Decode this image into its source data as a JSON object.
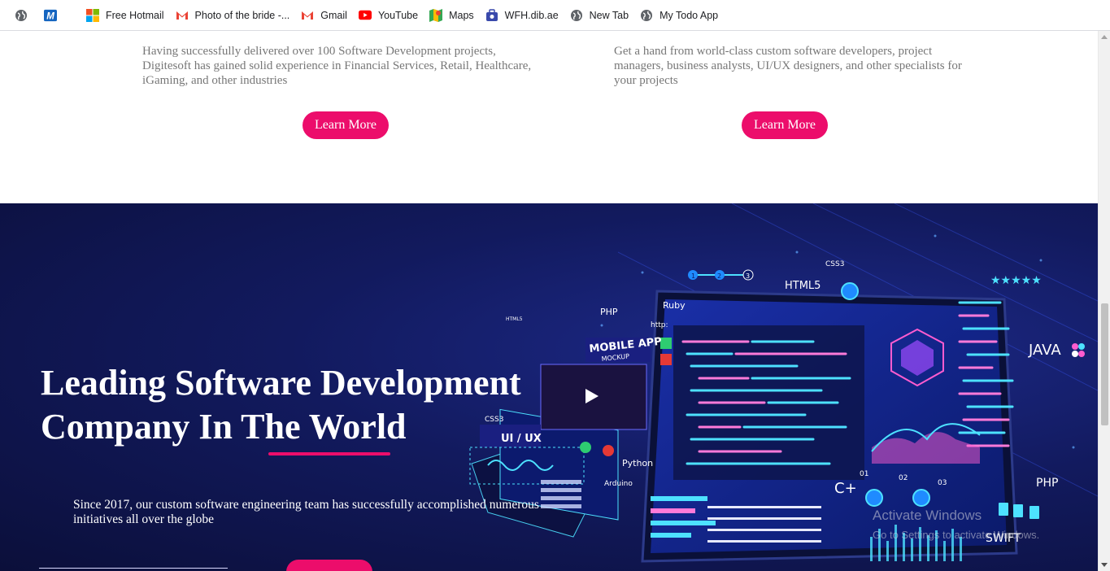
{
  "bookmarks": [
    {
      "label": "",
      "icon": "globe-icon"
    },
    {
      "label": "",
      "icon": "outlook-m-icon"
    },
    {
      "label": "Free Hotmail",
      "icon": "microsoft-icon"
    },
    {
      "label": "Photo of the bride -...",
      "icon": "gmail-icon"
    },
    {
      "label": "Gmail",
      "icon": "gmail-icon"
    },
    {
      "label": "YouTube",
      "icon": "youtube-icon"
    },
    {
      "label": "Maps",
      "icon": "maps-icon"
    },
    {
      "label": "WFH.dib.ae",
      "icon": "wfh-icon"
    },
    {
      "label": "New Tab",
      "icon": "globe-icon"
    },
    {
      "label": "My Todo App",
      "icon": "globe-icon"
    }
  ],
  "features": [
    {
      "text": "Having successfully delivered over 100 Software Development projects, Digitesoft has gained solid experience in Financial Services, Retail, Healthcare, iGaming, and other industries",
      "button": "Learn More"
    },
    {
      "text": "Get a hand from world-class custom software developers, project managers, business analysts, UI/UX designers, and other specialists for your projects",
      "button": "Learn More"
    }
  ],
  "hero": {
    "title_line1": "Leading Software Development",
    "title_line2": "Company In The World",
    "subtitle_line1": "Since 2017, our custom software engineering team has successfully accomplished numerous",
    "subtitle_line2": "initiatives all over the globe",
    "illustration_labels": {
      "php_top": "PHP",
      "ruby": "Ruby",
      "http": "http:",
      "html5": "HTML5",
      "css3_top": "CSS3",
      "mobile_app": "MOBILE APP",
      "mockup": "MOCKUP",
      "ui_ux": "UI / UX",
      "css3_left": "CSS3",
      "python": "Python",
      "arduino": "Arduino",
      "java": "JAVA",
      "php_right": "PHP",
      "swift": "SWIFT",
      "c_plus": "C+",
      "html5_small": "HTML5",
      "step1": "1",
      "step2": "2",
      "step3": "3",
      "num01": "01",
      "num02": "02",
      "num03": "03"
    }
  },
  "watermark": {
    "title": "Activate Windows",
    "subtitle": "Go to Settings to activate Windows."
  },
  "colors": {
    "accent": "#ec0d6b",
    "hero_bg": "#0b0f3a",
    "text_muted": "#777777"
  }
}
